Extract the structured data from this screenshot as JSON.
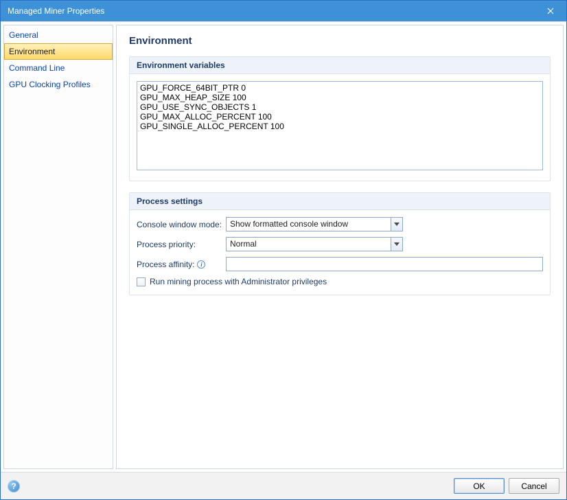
{
  "window": {
    "title": "Managed Miner Properties"
  },
  "sidebar": {
    "items": [
      {
        "label": "General"
      },
      {
        "label": "Environment"
      },
      {
        "label": "Command Line"
      },
      {
        "label": "GPU Clocking Profiles"
      }
    ],
    "selectedIndex": 1
  },
  "page": {
    "title": "Environment",
    "envGroup": {
      "header": "Environment variables",
      "value": "GPU_FORCE_64BIT_PTR 0\nGPU_MAX_HEAP_SIZE 100\nGPU_USE_SYNC_OBJECTS 1\nGPU_MAX_ALLOC_PERCENT 100\nGPU_SINGLE_ALLOC_PERCENT 100"
    },
    "procGroup": {
      "header": "Process settings",
      "consoleModeLabel": "Console window mode:",
      "consoleModeValue": "Show formatted console window",
      "priorityLabel": "Process priority:",
      "priorityValue": "Normal",
      "affinityLabel": "Process affinity:",
      "affinityValue": "",
      "adminCheckboxLabel": "Run mining process with Administrator privileges",
      "adminChecked": false
    }
  },
  "footer": {
    "okLabel": "OK",
    "cancelLabel": "Cancel"
  }
}
